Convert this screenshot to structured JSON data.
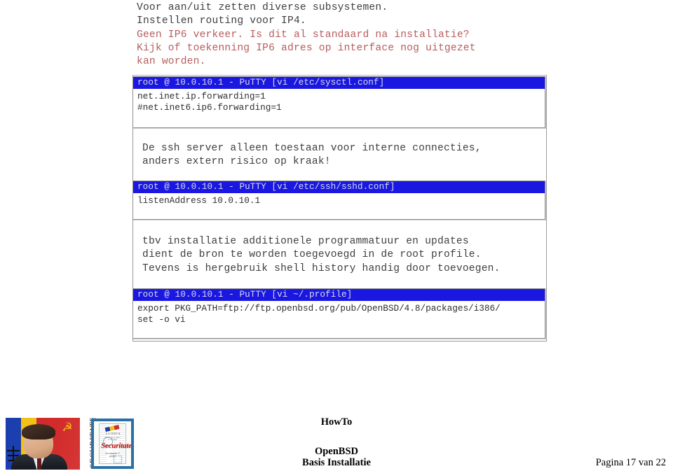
{
  "document": {
    "intro_paragraph": {
      "lines": [
        {
          "text": "Voor aan/uit zetten diverse subsystemen.",
          "color": "dark"
        },
        {
          "text": "Instellen routing voor IP4.",
          "color": "dark"
        },
        {
          "text": "Geen IP6 verkeer. Is dit al standaard na installatie?",
          "color": "red"
        },
        {
          "text": "Kijk of toekenning IP6 adres op interface nog uitgezet",
          "color": "red"
        },
        {
          "text": "kan worden.",
          "color": "red"
        }
      ]
    },
    "ssh_paragraph": {
      "lines": [
        {
          "text": "De ssh server alleen toestaan voor interne connecties,",
          "color": "dark"
        },
        {
          "text": "anders extern risico op kraak!",
          "color": "dark"
        }
      ]
    },
    "profile_paragraph": {
      "lines": [
        {
          "text": "tbv installatie additionele programmatuur en updates",
          "color": "dark"
        },
        {
          "text": "dient de bron te worden toegevoegd in de root profile.",
          "color": "dark"
        },
        {
          "text": "Tevens is hergebruik shell history handig door toevoegen.",
          "color": "dark"
        }
      ]
    }
  },
  "terminals": [
    {
      "id": "sysctl",
      "title": "root @ 10.0.10.1 - PuTTY [vi /etc/sysctl.conf]",
      "body": "net.inet.ip.forwarding=1\n#net.inet6.ip6.forwarding=1"
    },
    {
      "id": "sshd",
      "title": "root @ 10.0.10.1 - PuTTY [vi /etc/ssh/sshd.conf]",
      "body": "listenAddress 10.0.10.1"
    },
    {
      "id": "profile",
      "title": "root @ 10.0.10.1 - PuTTY [vi ~/.profile]",
      "body": "export PKG_PATH=ftp://ftp.openbsd.org/pub/OpenBSD/4.8/packages/i386/\nset -o vi"
    }
  ],
  "colors": {
    "title_bar_blue": "#1a18e0",
    "title_bar_text": "#d9d9e8",
    "red_text": "#b85c5c",
    "body_text": "#3f3f3f",
    "terminal_border": "#8d8d8d"
  },
  "logo": {
    "vertical_text": "SECURITATE.NL",
    "certificate": {
      "licenta": "LICENTA",
      "subtitle": "Autorizatie nr. 884 / 17.04.2001",
      "title": "Securitate",
      "tagline": "Uw waarde IT profile"
    }
  },
  "footer": {
    "howto": "HowTo",
    "product": "OpenBSD",
    "subtitle": "Basis Installatie",
    "page": "Pagina 17 van 22"
  }
}
